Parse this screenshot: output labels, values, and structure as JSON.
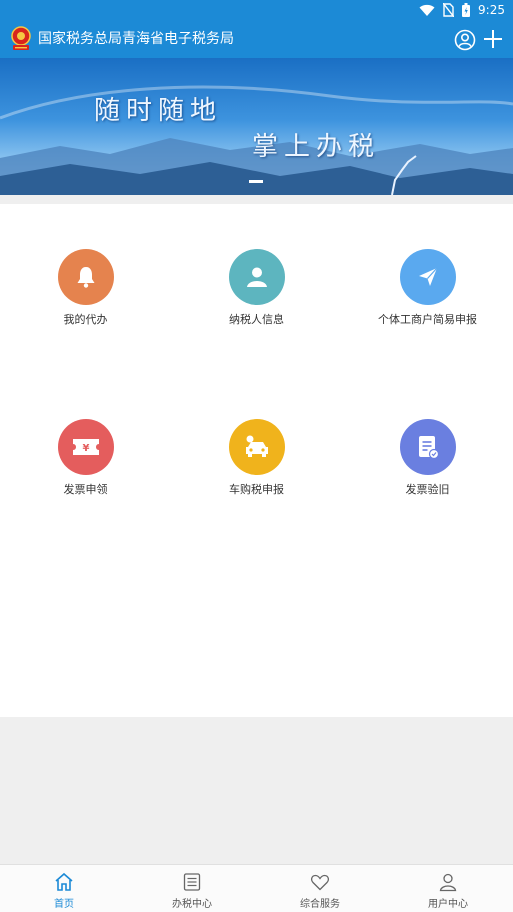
{
  "status_bar": {
    "time": "9:25"
  },
  "header": {
    "title": "国家税务总局青海省电子税务局",
    "icons": [
      "emblem-logo",
      "user-icon",
      "plus-icon"
    ]
  },
  "banner": {
    "line1": "随时随地",
    "line2": "掌上办税"
  },
  "grid": [
    {
      "label": "我的代办",
      "icon": "bell-icon",
      "color": "#e5834e"
    },
    {
      "label": "纳税人信息",
      "icon": "person-icon",
      "color": "#5db5bf"
    },
    {
      "label": "个体工商户简易申报",
      "icon": "paper-plane-icon",
      "color": "#5aa9ef"
    },
    {
      "label": "发票申领",
      "icon": "ticket-icon",
      "color": "#e45d5d"
    },
    {
      "label": "车购税申报",
      "icon": "car-icon",
      "color": "#f0b31c"
    },
    {
      "label": "发票验旧",
      "icon": "document-icon",
      "color": "#6a7fe0"
    }
  ],
  "tabs": [
    {
      "label": "首页",
      "icon": "home-icon",
      "active": true
    },
    {
      "label": "办税中心",
      "icon": "list-icon",
      "active": false
    },
    {
      "label": "综合服务",
      "icon": "heart-icon",
      "active": false
    },
    {
      "label": "用户中心",
      "icon": "user-icon",
      "active": false
    }
  ],
  "colors": {
    "primary": "#1c8ad6",
    "background": "#efefef",
    "active_tab": "#1c8ad6"
  }
}
